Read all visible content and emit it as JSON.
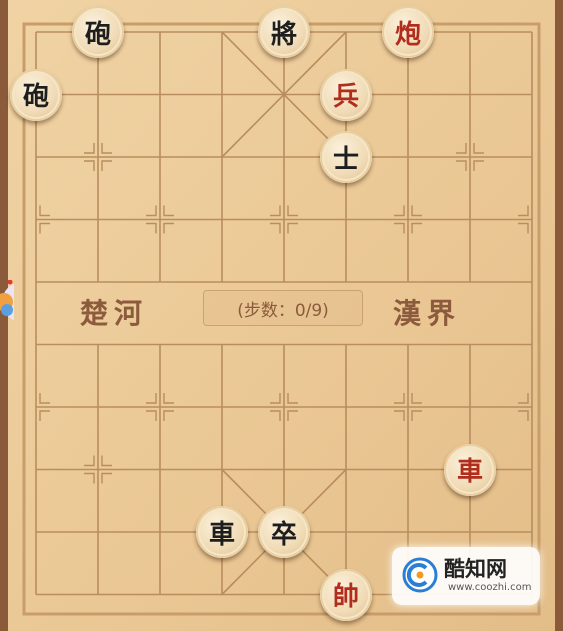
{
  "board": {
    "river_left": "楚河",
    "river_right": "漢界",
    "move_counter": "(步数：0/9)"
  },
  "pieces": [
    {
      "name": "black-cannon-top-left",
      "char": "砲",
      "side": "black",
      "file": 1,
      "rank": 0
    },
    {
      "name": "black-cannon-left",
      "char": "砲",
      "side": "black",
      "file": 0,
      "rank": 1
    },
    {
      "name": "black-general",
      "char": "將",
      "side": "black",
      "file": 4,
      "rank": 0
    },
    {
      "name": "red-cannon",
      "char": "炮",
      "side": "red",
      "file": 6,
      "rank": 0
    },
    {
      "name": "red-soldier",
      "char": "兵",
      "side": "red",
      "file": 5,
      "rank": 1
    },
    {
      "name": "black-advisor",
      "char": "士",
      "side": "black",
      "file": 5,
      "rank": 2
    },
    {
      "name": "red-chariot",
      "char": "車",
      "side": "red",
      "file": 7,
      "rank": 7
    },
    {
      "name": "black-chariot",
      "char": "車",
      "side": "black",
      "file": 3,
      "rank": 8
    },
    {
      "name": "black-soldier",
      "char": "卒",
      "side": "black",
      "file": 4,
      "rank": 8
    },
    {
      "name": "red-general",
      "char": "帥",
      "side": "red",
      "file": 5,
      "rank": 9
    }
  ],
  "watermark": {
    "name": "酷知网",
    "url": "www.coozhi.com"
  },
  "colors": {
    "frame": "#8a5a3a",
    "board": "#ecc995",
    "grid": "#b98d5e",
    "red_piece": "#b22d1c",
    "black_piece": "#1e1e1e"
  }
}
